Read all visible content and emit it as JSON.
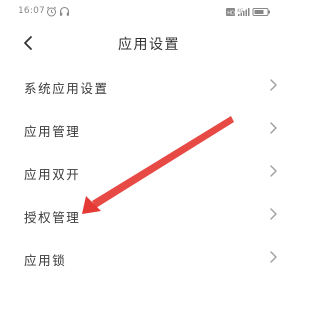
{
  "status_bar": {
    "time": "16:07",
    "icons": [
      "alarm-icon",
      "headphones-icon",
      "hd-icon",
      "signal-icon",
      "battery-icon"
    ]
  },
  "header": {
    "title": "应用设置",
    "back_icon": "chevron-left-icon"
  },
  "settings": {
    "items": [
      {
        "label": "系统应用设置"
      },
      {
        "label": "应用管理"
      },
      {
        "label": "应用双开"
      },
      {
        "label": "授权管理"
      },
      {
        "label": "应用锁"
      }
    ]
  },
  "annotation": {
    "color": "#e53935",
    "target": "授权管理"
  },
  "colors": {
    "text": "#333333",
    "chevron": "#9e9e9e",
    "status": "#888888"
  }
}
